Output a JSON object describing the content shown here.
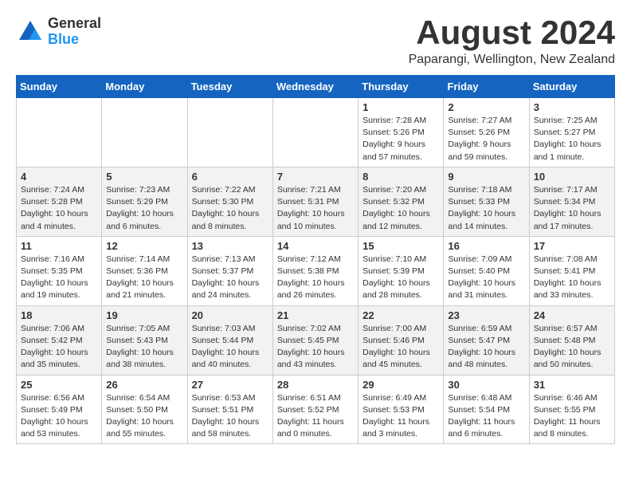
{
  "header": {
    "logo_general": "General",
    "logo_blue": "Blue",
    "month_title": "August 2024",
    "location": "Paparangi, Wellington, New Zealand"
  },
  "days_of_week": [
    "Sunday",
    "Monday",
    "Tuesday",
    "Wednesday",
    "Thursday",
    "Friday",
    "Saturday"
  ],
  "weeks": [
    [
      {
        "day": "",
        "info": ""
      },
      {
        "day": "",
        "info": ""
      },
      {
        "day": "",
        "info": ""
      },
      {
        "day": "",
        "info": ""
      },
      {
        "day": "1",
        "info": "Sunrise: 7:28 AM\nSunset: 5:26 PM\nDaylight: 9 hours\nand 57 minutes."
      },
      {
        "day": "2",
        "info": "Sunrise: 7:27 AM\nSunset: 5:26 PM\nDaylight: 9 hours\nand 59 minutes."
      },
      {
        "day": "3",
        "info": "Sunrise: 7:25 AM\nSunset: 5:27 PM\nDaylight: 10 hours\nand 1 minute."
      }
    ],
    [
      {
        "day": "4",
        "info": "Sunrise: 7:24 AM\nSunset: 5:28 PM\nDaylight: 10 hours\nand 4 minutes."
      },
      {
        "day": "5",
        "info": "Sunrise: 7:23 AM\nSunset: 5:29 PM\nDaylight: 10 hours\nand 6 minutes."
      },
      {
        "day": "6",
        "info": "Sunrise: 7:22 AM\nSunset: 5:30 PM\nDaylight: 10 hours\nand 8 minutes."
      },
      {
        "day": "7",
        "info": "Sunrise: 7:21 AM\nSunset: 5:31 PM\nDaylight: 10 hours\nand 10 minutes."
      },
      {
        "day": "8",
        "info": "Sunrise: 7:20 AM\nSunset: 5:32 PM\nDaylight: 10 hours\nand 12 minutes."
      },
      {
        "day": "9",
        "info": "Sunrise: 7:18 AM\nSunset: 5:33 PM\nDaylight: 10 hours\nand 14 minutes."
      },
      {
        "day": "10",
        "info": "Sunrise: 7:17 AM\nSunset: 5:34 PM\nDaylight: 10 hours\nand 17 minutes."
      }
    ],
    [
      {
        "day": "11",
        "info": "Sunrise: 7:16 AM\nSunset: 5:35 PM\nDaylight: 10 hours\nand 19 minutes."
      },
      {
        "day": "12",
        "info": "Sunrise: 7:14 AM\nSunset: 5:36 PM\nDaylight: 10 hours\nand 21 minutes."
      },
      {
        "day": "13",
        "info": "Sunrise: 7:13 AM\nSunset: 5:37 PM\nDaylight: 10 hours\nand 24 minutes."
      },
      {
        "day": "14",
        "info": "Sunrise: 7:12 AM\nSunset: 5:38 PM\nDaylight: 10 hours\nand 26 minutes."
      },
      {
        "day": "15",
        "info": "Sunrise: 7:10 AM\nSunset: 5:39 PM\nDaylight: 10 hours\nand 28 minutes."
      },
      {
        "day": "16",
        "info": "Sunrise: 7:09 AM\nSunset: 5:40 PM\nDaylight: 10 hours\nand 31 minutes."
      },
      {
        "day": "17",
        "info": "Sunrise: 7:08 AM\nSunset: 5:41 PM\nDaylight: 10 hours\nand 33 minutes."
      }
    ],
    [
      {
        "day": "18",
        "info": "Sunrise: 7:06 AM\nSunset: 5:42 PM\nDaylight: 10 hours\nand 35 minutes."
      },
      {
        "day": "19",
        "info": "Sunrise: 7:05 AM\nSunset: 5:43 PM\nDaylight: 10 hours\nand 38 minutes."
      },
      {
        "day": "20",
        "info": "Sunrise: 7:03 AM\nSunset: 5:44 PM\nDaylight: 10 hours\nand 40 minutes."
      },
      {
        "day": "21",
        "info": "Sunrise: 7:02 AM\nSunset: 5:45 PM\nDaylight: 10 hours\nand 43 minutes."
      },
      {
        "day": "22",
        "info": "Sunrise: 7:00 AM\nSunset: 5:46 PM\nDaylight: 10 hours\nand 45 minutes."
      },
      {
        "day": "23",
        "info": "Sunrise: 6:59 AM\nSunset: 5:47 PM\nDaylight: 10 hours\nand 48 minutes."
      },
      {
        "day": "24",
        "info": "Sunrise: 6:57 AM\nSunset: 5:48 PM\nDaylight: 10 hours\nand 50 minutes."
      }
    ],
    [
      {
        "day": "25",
        "info": "Sunrise: 6:56 AM\nSunset: 5:49 PM\nDaylight: 10 hours\nand 53 minutes."
      },
      {
        "day": "26",
        "info": "Sunrise: 6:54 AM\nSunset: 5:50 PM\nDaylight: 10 hours\nand 55 minutes."
      },
      {
        "day": "27",
        "info": "Sunrise: 6:53 AM\nSunset: 5:51 PM\nDaylight: 10 hours\nand 58 minutes."
      },
      {
        "day": "28",
        "info": "Sunrise: 6:51 AM\nSunset: 5:52 PM\nDaylight: 11 hours\nand 0 minutes."
      },
      {
        "day": "29",
        "info": "Sunrise: 6:49 AM\nSunset: 5:53 PM\nDaylight: 11 hours\nand 3 minutes."
      },
      {
        "day": "30",
        "info": "Sunrise: 6:48 AM\nSunset: 5:54 PM\nDaylight: 11 hours\nand 6 minutes."
      },
      {
        "day": "31",
        "info": "Sunrise: 6:46 AM\nSunset: 5:55 PM\nDaylight: 11 hours\nand 8 minutes."
      }
    ]
  ]
}
